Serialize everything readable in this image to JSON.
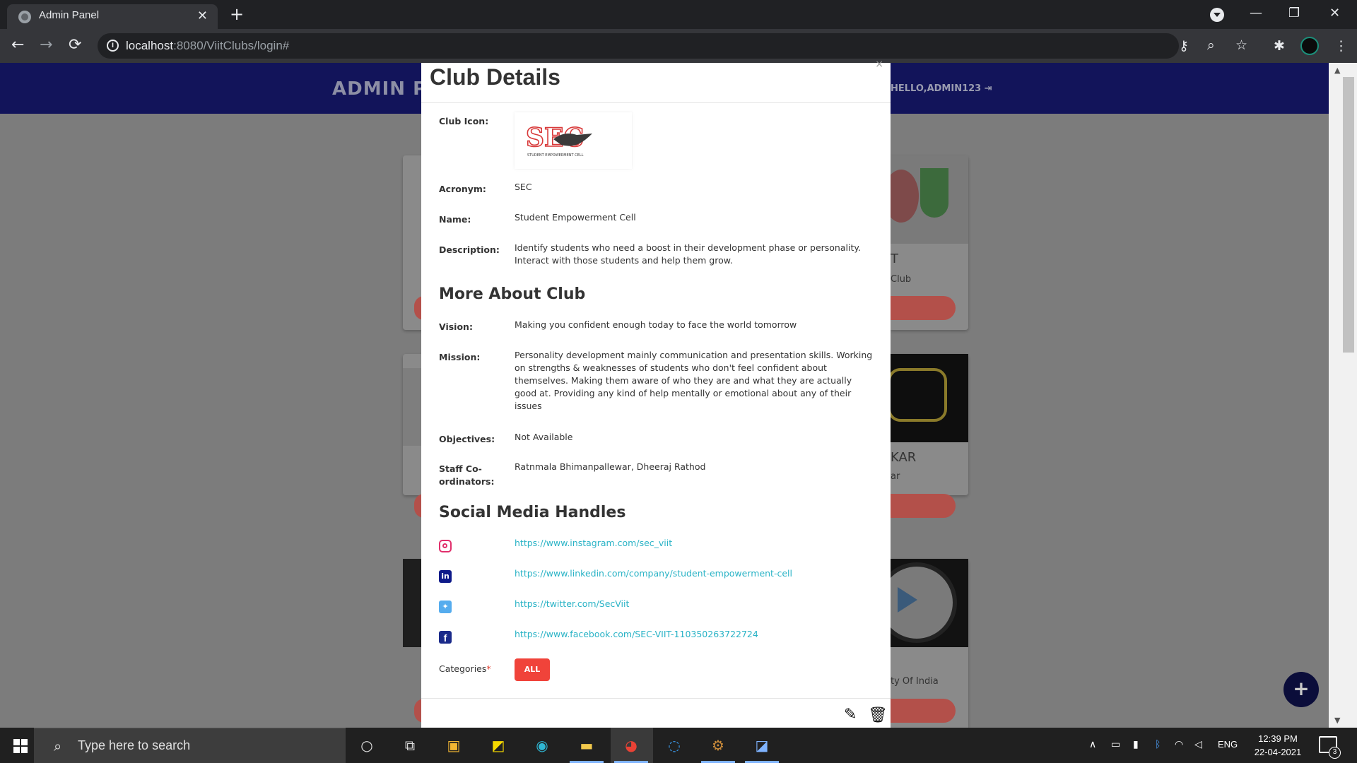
{
  "browser": {
    "tab_title": "Admin Panel",
    "tab_close": "✕",
    "new_tab": "+",
    "url_host": "localhost",
    "url_path": ":8080/ViitClubs/login#",
    "back": "←",
    "forward": "→",
    "reload": "⟳",
    "minimize": "—",
    "restore": "❐",
    "close": "✕"
  },
  "navbar": {
    "brand": "ADMIN P",
    "greeting": "HELLO,ADMIN123"
  },
  "background_cards": [
    {
      "title_fragment": "T",
      "subtitle_fragment": "Club"
    },
    {
      "title_fragment": "KAR",
      "subtitle_fragment": "ar"
    },
    {
      "title_fragment": "",
      "subtitle_fragment": "ty Of India"
    }
  ],
  "fab_label": "+",
  "modal": {
    "title": "Club Details",
    "close": "×",
    "fields": {
      "club_icon_label": "Club Icon:",
      "acronym_label": "Acronym:",
      "acronym": "SEC",
      "name_label": "Name:",
      "name": "Student Empowerment Cell",
      "description_label": "Description:",
      "description": "Identify students who need a boost in their development phase or personality. Interact with those students and help them grow."
    },
    "more_about": {
      "heading": "More About Club",
      "vision_label": "Vision:",
      "vision": "Making you confident enough today to face the world tomorrow",
      "mission_label": "Mission:",
      "mission": "Personality development mainly communication and presentation skills. Working on strengths & weaknesses of students who don't feel confident about themselves. Making them aware of who they are and what they are actually good at. Providing any kind of help mentally or emotional about any of their issues",
      "objectives_label": "Objectives:",
      "objectives": "Not Available",
      "staff_label": "Staff Co-ordinators:",
      "staff": "Ratnmala Bhimanpallewar, Dheeraj Rathod"
    },
    "social": {
      "heading": "Social Media Handles",
      "instagram": "https://www.instagram.com/sec_viit",
      "linkedin": "https://www.linkedin.com/company/student-empowerment-cell",
      "twitter": "https://twitter.com/SecViit",
      "facebook": "https://www.facebook.com/SEC-VIIT-110350263722724"
    },
    "categories_label": "Categories",
    "required_mark": "*",
    "category_all": "ALL",
    "logo_text": "SEC",
    "logo_subtext": "STUDENT EMPOWERMENT CELL",
    "colors": {
      "link": "#2ab3c6",
      "category_button": "#f0433a",
      "instagram": "#e1306c",
      "linkedin": "#0e1a8a",
      "twitter": "#55acee",
      "facebook": "#1a2a8a"
    }
  },
  "taskbar": {
    "search_placeholder": "Type here to search",
    "language": "ENG",
    "time": "12:39 PM",
    "date": "22-04-2021",
    "notification_count": "3"
  }
}
